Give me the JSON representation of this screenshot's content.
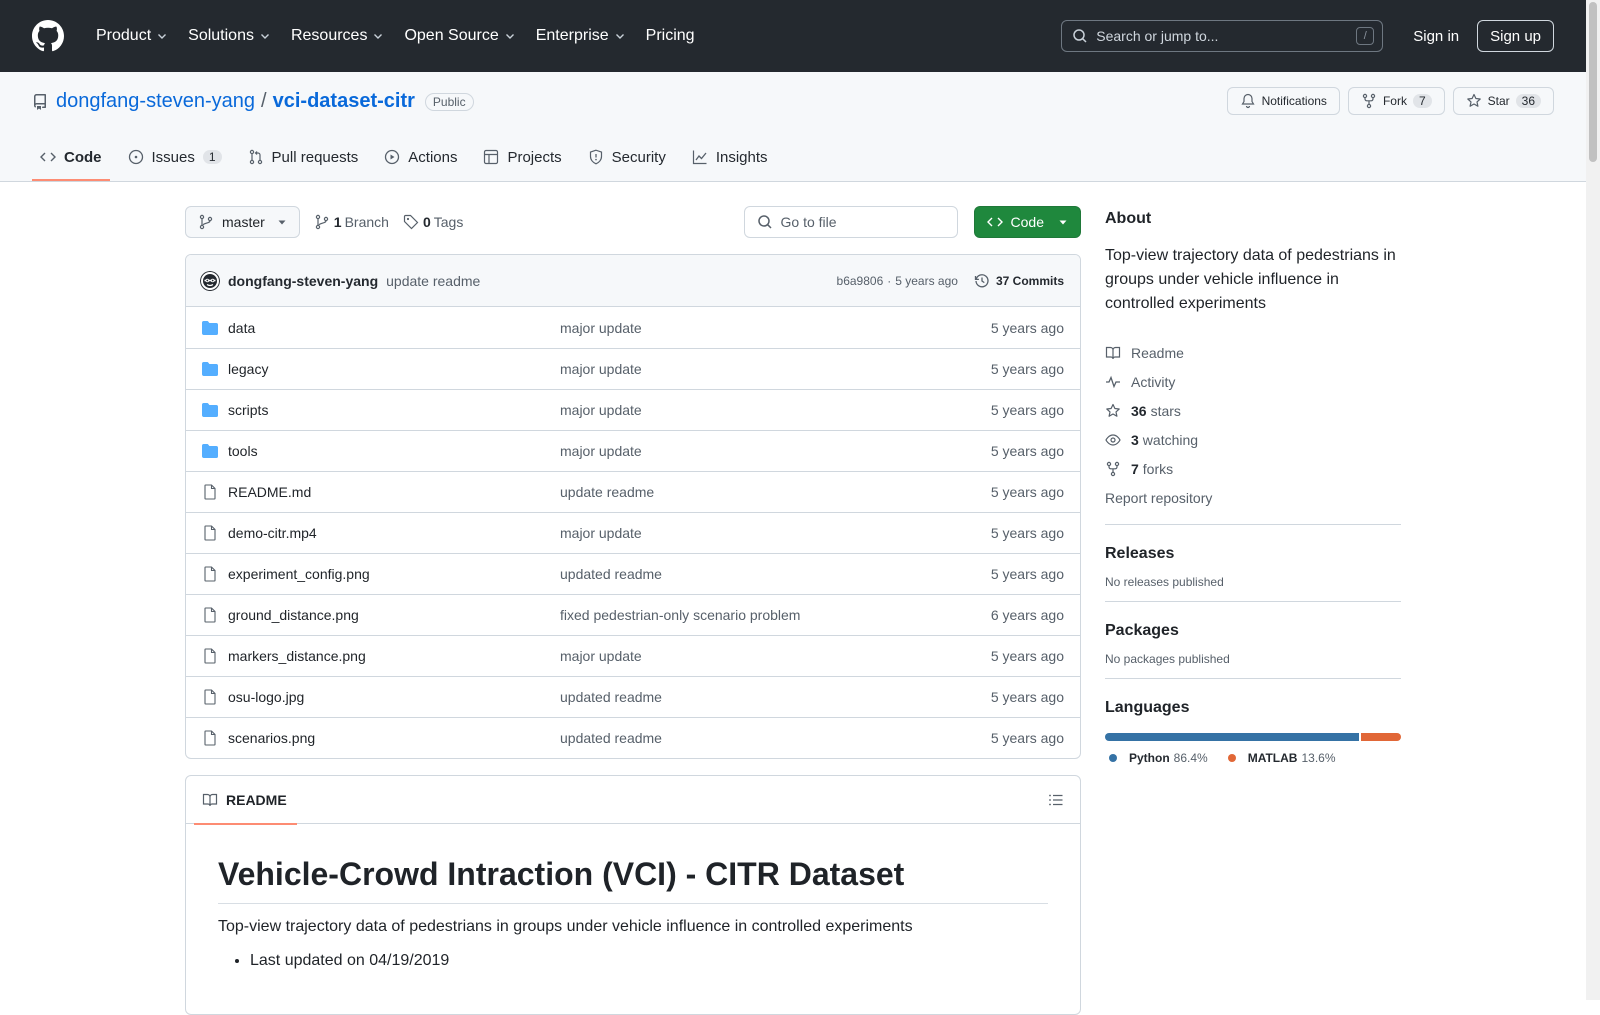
{
  "header": {
    "nav": [
      {
        "label": "Product",
        "caret": true
      },
      {
        "label": "Solutions",
        "caret": true
      },
      {
        "label": "Resources",
        "caret": true
      },
      {
        "label": "Open Source",
        "caret": true
      },
      {
        "label": "Enterprise",
        "caret": true
      },
      {
        "label": "Pricing",
        "caret": false
      }
    ],
    "search_placeholder": "Search or jump to...",
    "search_key": "/",
    "sign_in": "Sign in",
    "sign_up": "Sign up"
  },
  "repo": {
    "owner": "dongfang-steven-yang",
    "separator": "/",
    "name": "vci-dataset-citr",
    "visibility": "Public",
    "notifications_label": "Notifications",
    "fork_label": "Fork",
    "fork_count": "7",
    "star_label": "Star",
    "star_count": "36",
    "tabs": {
      "code": "Code",
      "issues": "Issues",
      "issues_count": "1",
      "pulls": "Pull requests",
      "actions": "Actions",
      "projects": "Projects",
      "security": "Security",
      "insights": "Insights"
    }
  },
  "toolbar": {
    "branch": "master",
    "branch_count": "1",
    "branch_label": "Branch",
    "tag_count": "0",
    "tag_label": "Tags",
    "goto_placeholder": "Go to file",
    "code_button": "Code"
  },
  "commit": {
    "author": "dongfang-steven-yang",
    "message": "update readme",
    "sha": "b6a9806",
    "dot": "·",
    "age": "5 years ago",
    "commits_label": "37 Commits"
  },
  "files": [
    {
      "type": "dir",
      "name": "data",
      "message": "major update",
      "age": "5 years ago"
    },
    {
      "type": "dir",
      "name": "legacy",
      "message": "major update",
      "age": "5 years ago"
    },
    {
      "type": "dir",
      "name": "scripts",
      "message": "major update",
      "age": "5 years ago"
    },
    {
      "type": "dir",
      "name": "tools",
      "message": "major update",
      "age": "5 years ago"
    },
    {
      "type": "file",
      "name": "README.md",
      "message": "update readme",
      "age": "5 years ago"
    },
    {
      "type": "file",
      "name": "demo-citr.mp4",
      "message": "major update",
      "age": "5 years ago"
    },
    {
      "type": "file",
      "name": "experiment_config.png",
      "message": "updated readme",
      "age": "5 years ago"
    },
    {
      "type": "file",
      "name": "ground_distance.png",
      "message": "fixed pedestrian-only scenario problem",
      "age": "6 years ago"
    },
    {
      "type": "file",
      "name": "markers_distance.png",
      "message": "major update",
      "age": "5 years ago"
    },
    {
      "type": "file",
      "name": "osu-logo.jpg",
      "message": "updated readme",
      "age": "5 years ago"
    },
    {
      "type": "file",
      "name": "scenarios.png",
      "message": "updated readme",
      "age": "5 years ago"
    }
  ],
  "readme": {
    "tab_label": "README",
    "title": "Vehicle-Crowd Intraction (VCI) - CITR Dataset",
    "intro": "Top-view trajectory data of pedestrians in groups under vehicle influence in controlled experiments",
    "bullets": [
      "Last updated on 04/19/2019"
    ]
  },
  "sidebar": {
    "about_title": "About",
    "description": "Top-view trajectory data of pedestrians in groups under vehicle influence in controlled experiments",
    "readme_label": "Readme",
    "activity_label": "Activity",
    "stars_count": "36",
    "stars_label": "stars",
    "watching_count": "3",
    "watching_label": "watching",
    "forks_count": "7",
    "forks_label": "forks",
    "report_label": "Report repository",
    "releases_title": "Releases",
    "releases_note": "No releases published",
    "packages_title": "Packages",
    "packages_note": "No packages published",
    "languages_title": "Languages",
    "languages": [
      {
        "name": "Python",
        "percent": "86.4%",
        "value": 86.4,
        "color": "#3572A5"
      },
      {
        "name": "MATLAB",
        "percent": "13.6%",
        "value": 13.6,
        "color": "#e16737"
      }
    ]
  }
}
